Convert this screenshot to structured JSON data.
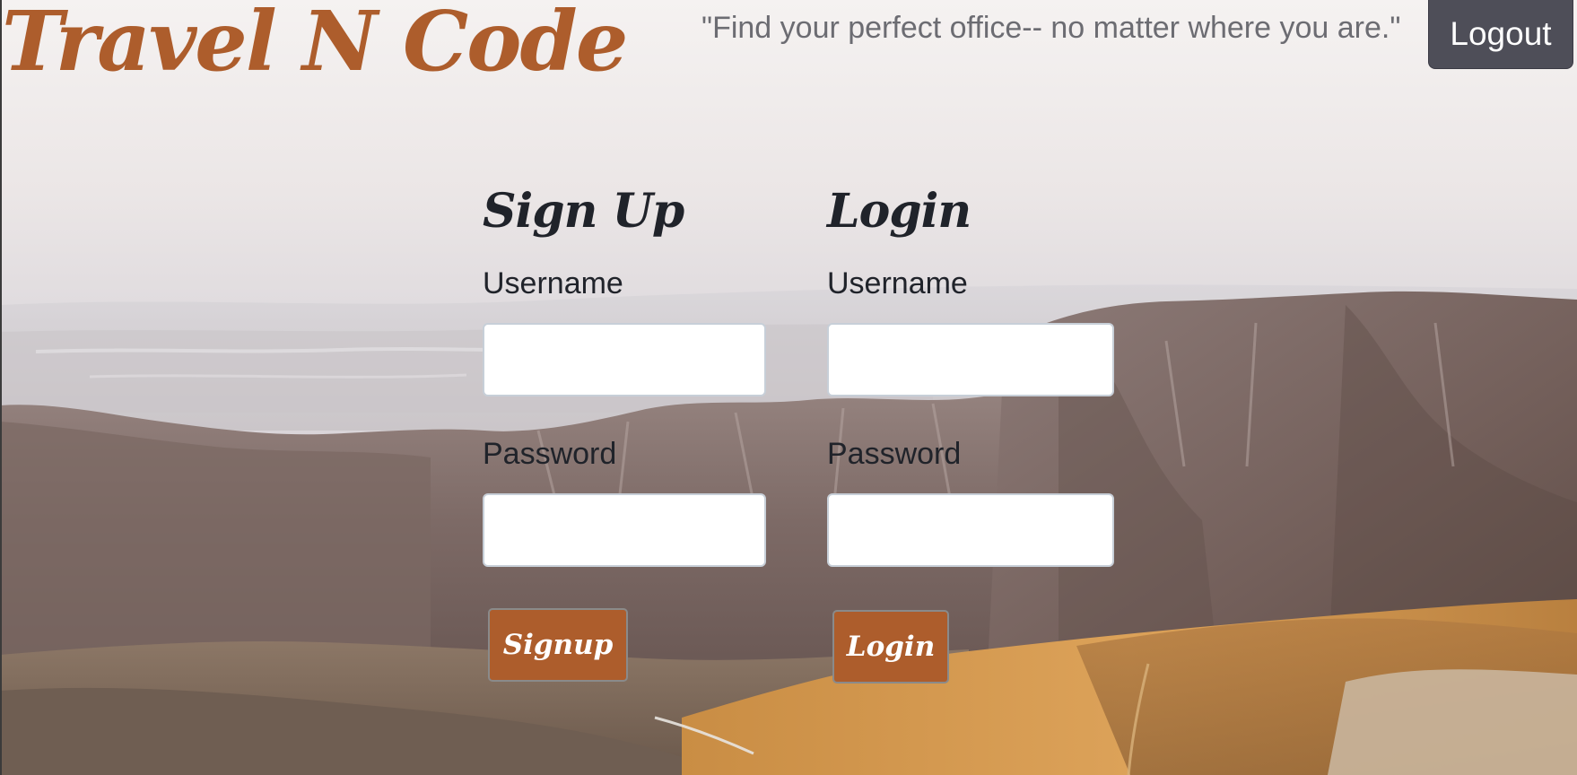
{
  "header": {
    "brand": "Travel N Code",
    "tagline": "\"Find your perfect office-- no matter where you are.\"",
    "logout_label": "Logout"
  },
  "signup": {
    "title": "Sign Up",
    "username_label": "Username",
    "password_label": "Password",
    "username_value": "",
    "password_value": "",
    "submit_label": "Signup"
  },
  "login": {
    "title": "Login",
    "username_label": "Username",
    "password_label": "Password",
    "username_value": "",
    "password_value": "",
    "submit_label": "Login"
  },
  "colors": {
    "brand": "#ad5d2c",
    "logout_bg": "#4e4e58",
    "heading": "#20232a",
    "tagline": "#6c6c72"
  }
}
